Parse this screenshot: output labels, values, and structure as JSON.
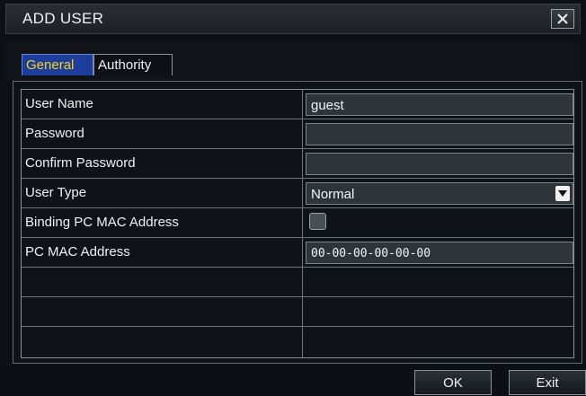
{
  "window": {
    "title": "ADD USER",
    "close_icon": "close-icon"
  },
  "tabs": [
    {
      "label": "General",
      "active": true
    },
    {
      "label": "Authority",
      "active": false
    }
  ],
  "form": {
    "rows": [
      {
        "label": "User Name",
        "type": "text",
        "value": "guest"
      },
      {
        "label": "Password",
        "type": "password",
        "value": ""
      },
      {
        "label": "Confirm Password",
        "type": "password",
        "value": ""
      },
      {
        "label": "User Type",
        "type": "select",
        "value": "Normal"
      },
      {
        "label": "Binding PC MAC Address",
        "type": "checkbox",
        "checked": false
      },
      {
        "label": "PC MAC Address",
        "type": "text",
        "value": "00-00-00-00-00-00"
      }
    ]
  },
  "buttons": {
    "ok_label": "OK",
    "exit_label": "Exit"
  },
  "colors": {
    "active_tab_bg": "#1d3e9c",
    "active_tab_text": "#f7d316",
    "field_bg": "#2f3439"
  }
}
